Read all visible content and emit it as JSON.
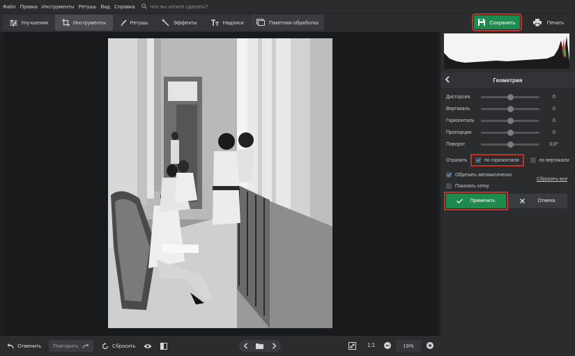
{
  "menu": [
    "Файл",
    "Правка",
    "Инструменты",
    "Ретушь",
    "Вид",
    "Справка"
  ],
  "search": {
    "placeholder": "Что вы хотите сделать?"
  },
  "tabs": [
    {
      "label": "Улучшения",
      "icon": "sliders-icon"
    },
    {
      "label": "Инструменты",
      "icon": "crop-icon",
      "active": true
    },
    {
      "label": "Ретушь",
      "icon": "brush-icon"
    },
    {
      "label": "Эффекты",
      "icon": "magic-wand-icon"
    },
    {
      "label": "Надписи",
      "icon": "text-icon"
    }
  ],
  "batch_label": "Пакетная обработка",
  "save_label": "Сохранить",
  "print_label": "Печать",
  "panel": {
    "title": "Геометрия",
    "sliders": [
      {
        "label": "Дисторсия",
        "value": "0",
        "level": 0.5
      },
      {
        "label": "Вертикаль",
        "value": "0",
        "level": 0.5
      },
      {
        "label": "Горизонталь",
        "value": "0",
        "level": 0.5
      },
      {
        "label": "Пропорции",
        "value": "0",
        "level": 0.5
      },
      {
        "label": "Поворот",
        "value": "0,0°",
        "level": 0.5
      }
    ],
    "flip_label": "Отразить",
    "flip_horizontal": {
      "label": "по горизонтали",
      "checked": true
    },
    "flip_vertical": {
      "label": "по вертикали",
      "checked": false
    },
    "auto_crop": {
      "label": "Обрезать автоматически",
      "checked": true
    },
    "show_grid": {
      "label": "Показать сетку",
      "checked": false
    },
    "reset_all": "Сбросить все",
    "apply_label": "Применить",
    "cancel_label": "Отмена"
  },
  "bottom": {
    "undo_label": "Отменить",
    "redo_label": "Повторить",
    "reset_label": "Сбросить",
    "zoom_ratio": "1:1",
    "zoom_value": "19%"
  },
  "colors": {
    "accent_green": "#1e8a4e",
    "highlight_red": "#c4302b",
    "panel_bg": "#2b2c2e",
    "canvas_bg": "#191a1c"
  }
}
